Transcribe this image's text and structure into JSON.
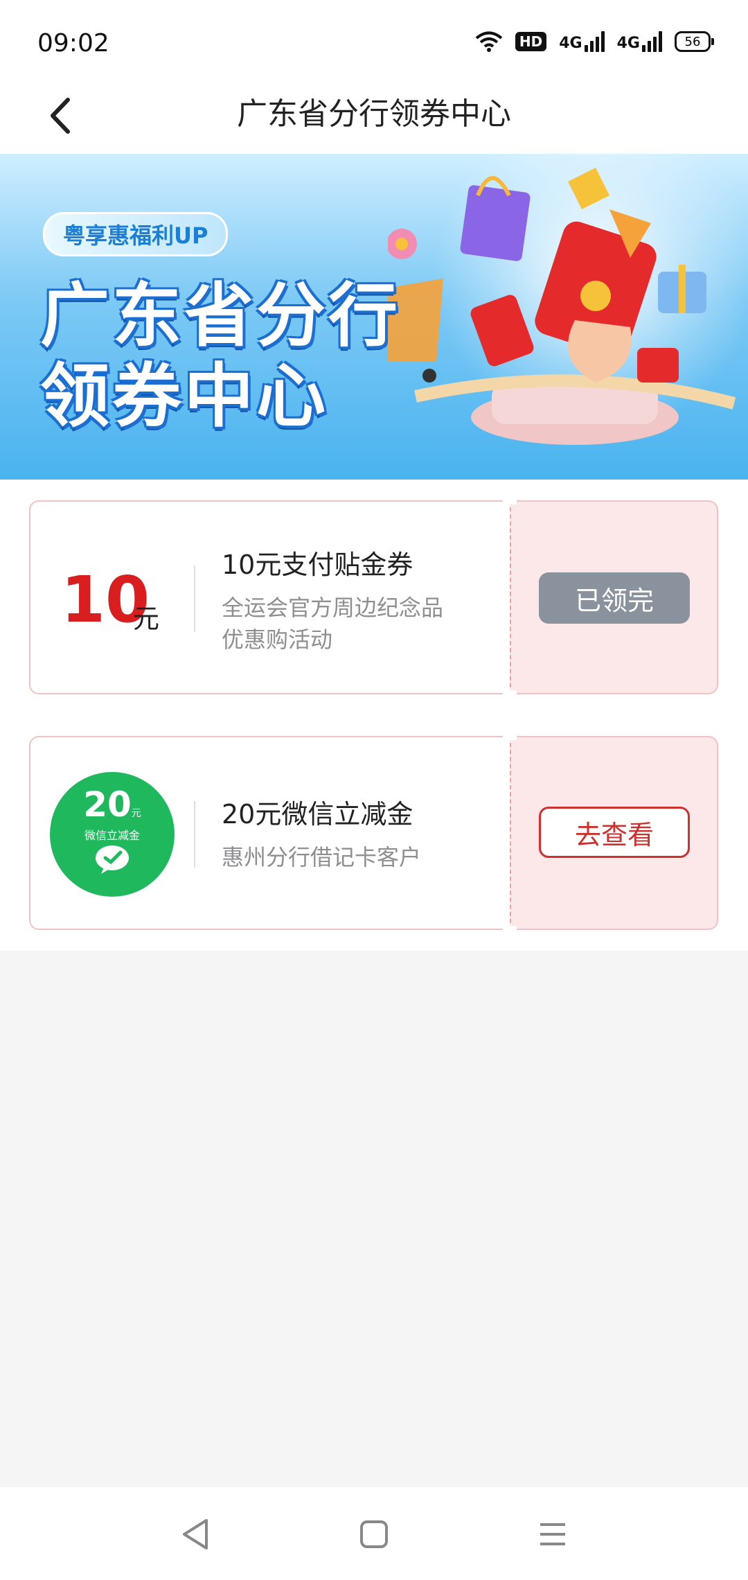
{
  "status": {
    "time": "09:02",
    "hd": "HD",
    "net1": "4G",
    "net2": "4G",
    "battery": "56"
  },
  "nav": {
    "title": "广东省分行领券中心"
  },
  "banner": {
    "tag": "粤享惠福利UP",
    "title_line1": "广东省分行",
    "title_line2": "领券中心"
  },
  "coupons": [
    {
      "amount": "10",
      "unit": "元",
      "title": "10元支付贴金券",
      "desc_line1": "全运会官方周边纪念品",
      "desc_line2": "优惠购活动",
      "button": "已领完"
    },
    {
      "badge_amount": "20",
      "badge_unit": "元",
      "badge_label": "微信立减金",
      "title": "20元微信立减金",
      "desc_line1": "惠州分行借记卡客户",
      "button": "去查看"
    }
  ],
  "colors": {
    "accent_red": "#d81e1e",
    "wechat_green": "#1fb85c",
    "claimed_gray": "#8a929e"
  },
  "icons": {
    "back": "chevron-left-icon",
    "wechat": "wechat-icon",
    "nav_back": "triangle-back-icon",
    "nav_home": "square-home-icon",
    "nav_menu": "menu-lines-icon"
  }
}
